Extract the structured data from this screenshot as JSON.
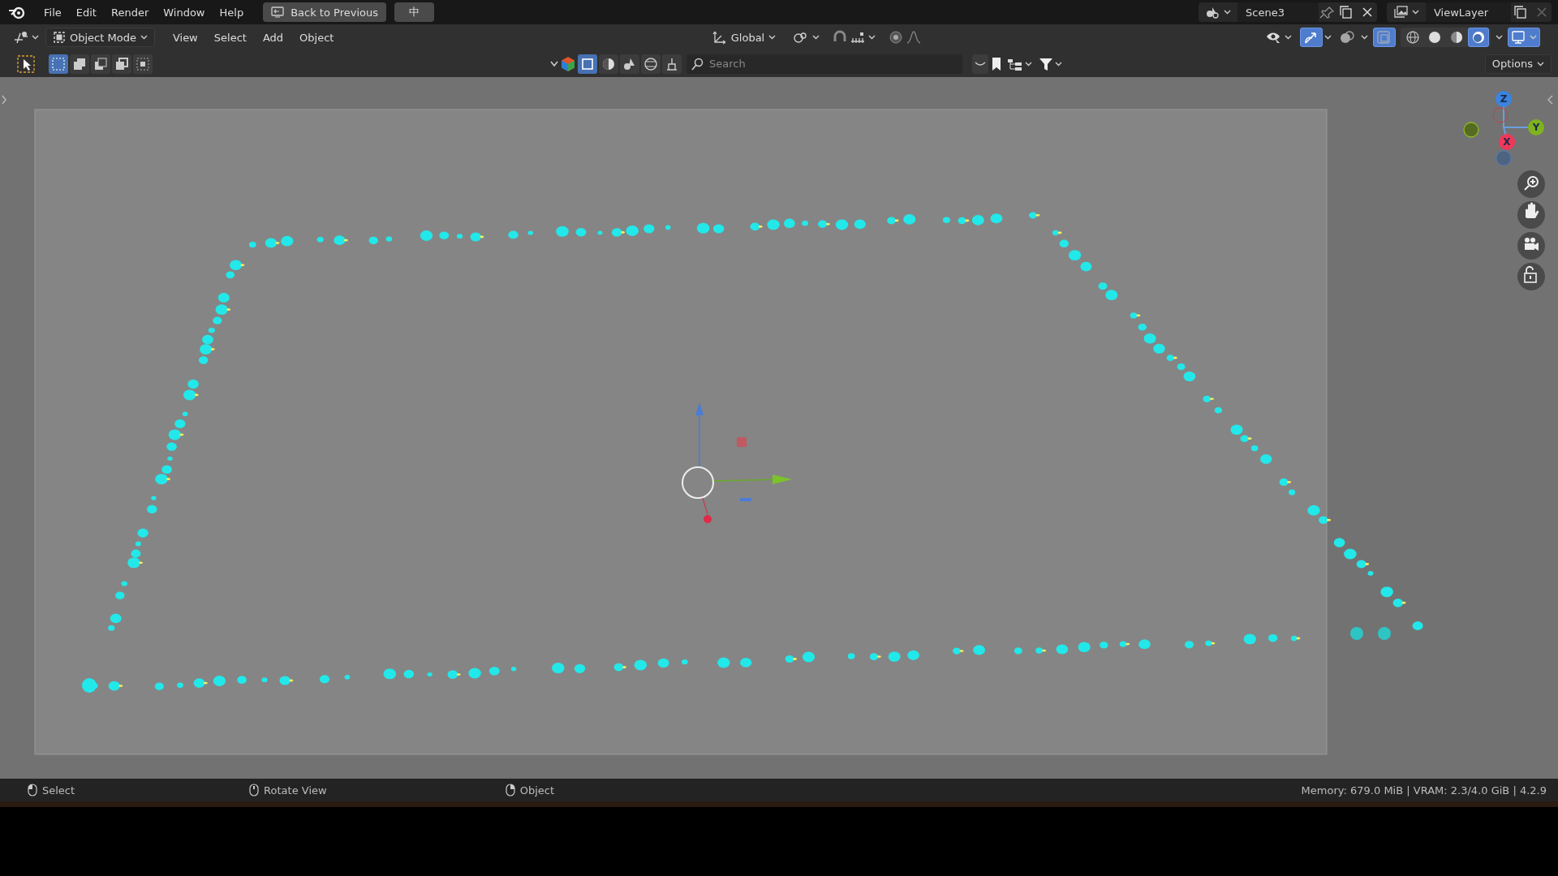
{
  "top_bar": {
    "menus": [
      "File",
      "Edit",
      "Render",
      "Window",
      "Help"
    ],
    "back_button": "Back to Previous",
    "extra_button": "中",
    "scene": "Scene3",
    "view_layer": "ViewLayer"
  },
  "header": {
    "mode": "Object Mode",
    "menus": [
      "View",
      "Select",
      "Add",
      "Object"
    ],
    "orientation": "Global",
    "toggles": [
      {
        "kind": "gizmos",
        "on": true
      },
      {
        "kind": "overlays",
        "on": false
      },
      {
        "kind": "xray",
        "on": true
      }
    ],
    "shading": [
      {
        "kind": "wireframe",
        "selected": false
      },
      {
        "kind": "solid",
        "selected": false
      },
      {
        "kind": "material",
        "selected": false
      },
      {
        "kind": "rendered",
        "selected": true
      }
    ]
  },
  "tool_header": {
    "select_modes": [
      {
        "kind": "new",
        "selected": true
      },
      {
        "kind": "extend",
        "selected": false
      },
      {
        "kind": "subtract",
        "selected": false
      },
      {
        "kind": "difference",
        "selected": false
      },
      {
        "kind": "intersect",
        "selected": false
      }
    ],
    "search": {
      "placeholder": "Search"
    },
    "options": "Options"
  },
  "gizmo": {
    "axes": [
      {
        "label": "Z"
      },
      {
        "label": "Y"
      },
      {
        "label": "X"
      }
    ]
  },
  "status_bar": {
    "hints": [
      "Select",
      "Rotate View",
      "Object"
    ],
    "stats": "Memory: 679.0 MiB | VRAM: 2.3/4.0 GiB | 4.2.9"
  }
}
